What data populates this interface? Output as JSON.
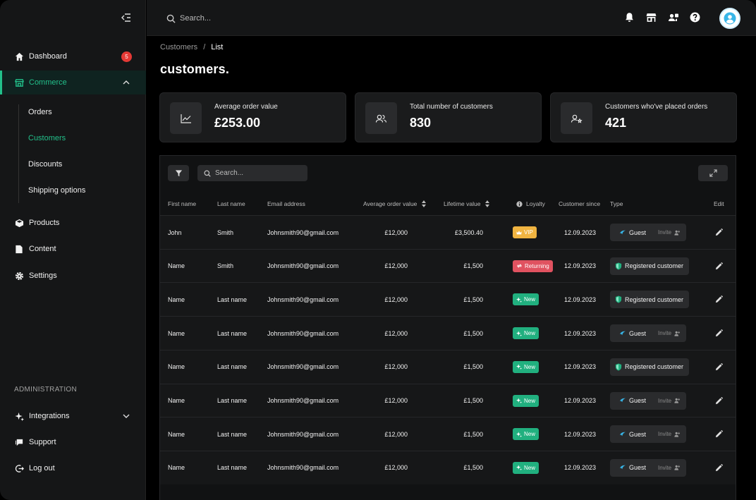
{
  "sidebar": {
    "nav": [
      {
        "label": "Dashboard",
        "icon": "home-icon",
        "badge": "5"
      },
      {
        "label": "Commerce",
        "icon": "store-icon",
        "active": true
      },
      {
        "label": "Products",
        "icon": "cube-icon"
      },
      {
        "label": "Content",
        "icon": "document-icon"
      },
      {
        "label": "Settings",
        "icon": "gear-icon"
      }
    ],
    "commerce_sub": [
      "Orders",
      "Customers",
      "Discounts",
      "Shipping options"
    ],
    "active_sub": "Customers",
    "admin_label": "ADMINISTRATION",
    "admin_nav": [
      {
        "label": "Integrations",
        "icon": "sparkle-icon"
      },
      {
        "label": "Support",
        "icon": "chat-icon"
      },
      {
        "label": "Log out",
        "icon": "logout-icon"
      }
    ]
  },
  "topbar": {
    "search_placeholder": "Search...",
    "icons": [
      "bell-icon",
      "store-icon",
      "users-icon",
      "help-icon",
      "avatar"
    ]
  },
  "breadcrumb": {
    "parent": "Customers",
    "sep": "/",
    "current": "List"
  },
  "page_title": "customers.",
  "stats": [
    {
      "label": "Average order value",
      "value": "£253.00",
      "icon": "chart-icon"
    },
    {
      "label": "Total number of customers",
      "value": "830",
      "icon": "users-icon"
    },
    {
      "label": "Customers who've  placed orders",
      "value": "421",
      "icon": "user-star-icon"
    }
  ],
  "table": {
    "search_placeholder": "Search...",
    "headers": {
      "first": "First name",
      "last": "Last name",
      "email": "Email address",
      "aov": "Average order value",
      "lifetime": "Lifetime value",
      "loyalty": "Loyalty",
      "since": "Customer since",
      "type": "Type",
      "edit": "Edit"
    },
    "invite_label": "Invite",
    "rows": [
      {
        "first": "John",
        "last": "Smith",
        "email": "Johnsmith90@gmail.com",
        "aov": "£12,000",
        "lifetime": "£3,500.40",
        "loyalty": "VIP",
        "loyalty_kind": "vip",
        "since": "12.09.2023",
        "type": "Guest",
        "type_kind": "guest"
      },
      {
        "first": "Name",
        "last": "Smith",
        "email": "Johnsmith90@gmail.com",
        "aov": "£12,000",
        "lifetime": "£1,500",
        "loyalty": "Returning",
        "loyalty_kind": "ret",
        "since": "12.09.2023",
        "type": "Registered customer",
        "type_kind": "reg"
      },
      {
        "first": "Name",
        "last": "Last name",
        "email": "Johnsmith90@gmail.com",
        "aov": "£12,000",
        "lifetime": "£1,500",
        "loyalty": "New",
        "loyalty_kind": "new",
        "since": "12.09.2023",
        "type": "Registered customer",
        "type_kind": "reg"
      },
      {
        "first": "Name",
        "last": "Last name",
        "email": "Johnsmith90@gmail.com",
        "aov": "£12,000",
        "lifetime": "£1,500",
        "loyalty": "New",
        "loyalty_kind": "new",
        "since": "12.09.2023",
        "type": "Guest",
        "type_kind": "guest"
      },
      {
        "first": "Name",
        "last": "Last name",
        "email": "Johnsmith90@gmail.com",
        "aov": "£12,000",
        "lifetime": "£1,500",
        "loyalty": "New",
        "loyalty_kind": "new",
        "since": "12.09.2023",
        "type": "Registered customer",
        "type_kind": "reg"
      },
      {
        "first": "Name",
        "last": "Last name",
        "email": "Johnsmith90@gmail.com",
        "aov": "£12,000",
        "lifetime": "£1,500",
        "loyalty": "New",
        "loyalty_kind": "new",
        "since": "12.09.2023",
        "type": "Guest",
        "type_kind": "guest"
      },
      {
        "first": "Name",
        "last": "Last name",
        "email": "Johnsmith90@gmail.com",
        "aov": "£12,000",
        "lifetime": "£1,500",
        "loyalty": "New",
        "loyalty_kind": "new",
        "since": "12.09.2023",
        "type": "Guest",
        "type_kind": "guest"
      },
      {
        "first": "Name",
        "last": "Last name",
        "email": "Johnsmith90@gmail.com",
        "aov": "£12,000",
        "lifetime": "£1,500",
        "loyalty": "New",
        "loyalty_kind": "new",
        "since": "12.09.2023",
        "type": "Guest",
        "type_kind": "guest"
      }
    ]
  },
  "colors": {
    "accent": "#22c08a",
    "badge": "#e53935",
    "vip": "#f0b441",
    "returning": "#e05260",
    "new": "#21b07f"
  }
}
